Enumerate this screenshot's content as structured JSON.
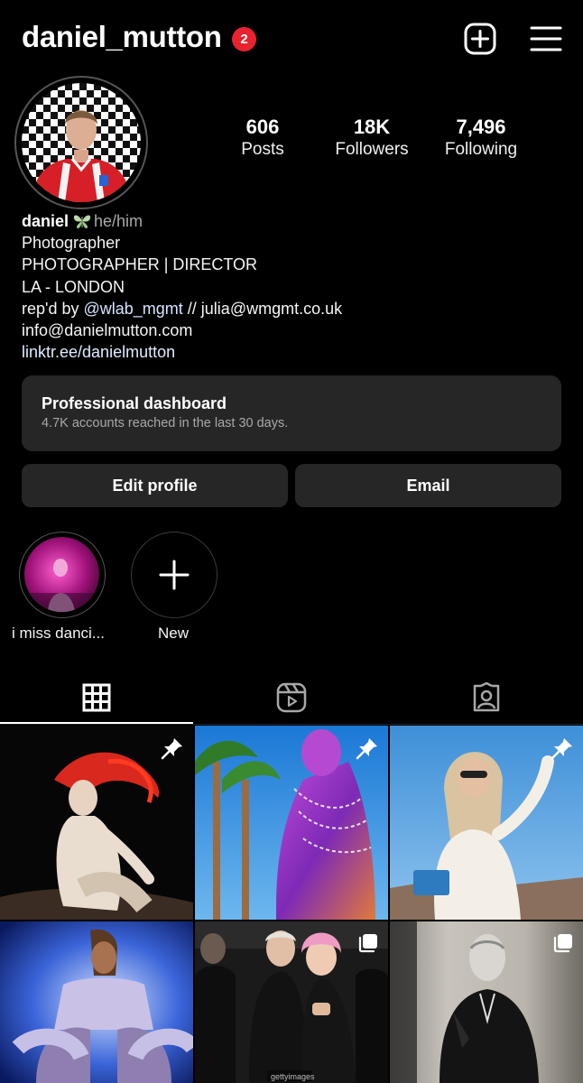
{
  "header": {
    "username": "daniel_mutton",
    "notification_count": "2",
    "create_icon": "plus-square-icon",
    "menu_icon": "hamburger-menu-icon"
  },
  "stats": [
    {
      "value": "606",
      "label": "Posts"
    },
    {
      "value": "18K",
      "label": "Followers"
    },
    {
      "value": "7,496",
      "label": "Following"
    }
  ],
  "bio": {
    "name": "daniel",
    "emoji_icon": "butterfly-icon",
    "pronouns": "he/him",
    "category": "Photographer",
    "line1": "PHOTOGRAPHER | DIRECTOR",
    "line2": "LA - LONDON",
    "line3_prefix": "rep'd by ",
    "line3_mention": "@wlab_mgmt",
    "line3_suffix": " // julia@wmgmt.co.uk",
    "email": "info@danielmutton.com",
    "link": "linktr.ee/danielmutton"
  },
  "dashboard": {
    "title": "Professional dashboard",
    "subtitle": "4.7K accounts reached in the last 30 days."
  },
  "buttons": {
    "edit_profile": "Edit profile",
    "email": "Email"
  },
  "highlights": [
    {
      "label": "i miss danci..."
    },
    {
      "label": "New"
    }
  ],
  "tabs": [
    {
      "icon": "grid-icon",
      "active": true
    },
    {
      "icon": "reels-icon",
      "active": false
    },
    {
      "icon": "tagged-icon",
      "active": false
    }
  ],
  "posts": [
    {
      "badge": "pin-icon"
    },
    {
      "badge": "pin-icon"
    },
    {
      "badge": "pin-icon"
    },
    {
      "badge": "none"
    },
    {
      "badge": "multiple-images-icon"
    },
    {
      "badge": "multiple-images-icon"
    }
  ],
  "watermark": "gettyimages",
  "colors": {
    "background": "#000000",
    "surface": "#262626",
    "badge_red": "#e8232f",
    "muted_text": "#a8a8a8"
  }
}
